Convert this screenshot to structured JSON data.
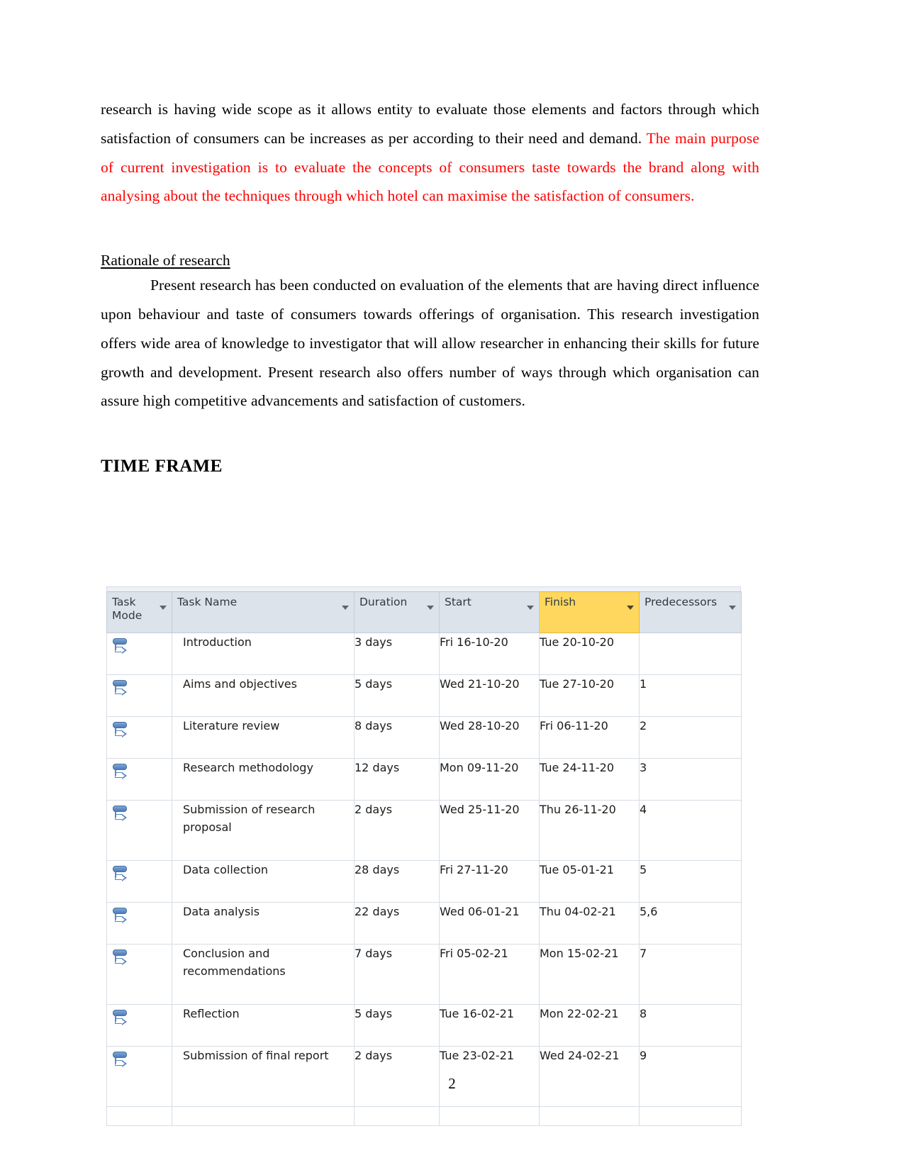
{
  "document": {
    "paragraph_1": {
      "black_part": "research is having wide scope as it allows entity to evaluate those elements and factors through which satisfaction of consumers can be increases as per according to their need and demand.",
      "red_part": " The main purpose of current investigation is to evaluate the concepts of consumers taste towards the brand along with analysing about the techniques through which hotel can maximise the satisfaction of consumers."
    },
    "rationale_heading": "Rationale of research",
    "paragraph_2": "Present research has been conducted on evaluation of the elements that are having direct influence upon behaviour and taste of consumers towards offerings of organisation. This research investigation offers wide area of knowledge to investigator that will allow researcher in enhancing their skills for future growth and development. Present research also offers number of ways through which organisation can assure high competitive advancements and satisfaction of customers.",
    "time_frame_heading": "TIME FRAME",
    "page_number": "2"
  },
  "colors": {
    "red_text": "#ff0000",
    "header_background": "#dde3ea",
    "finish_column_highlight": "#ffd75e",
    "grid_line": "#d6dde4",
    "task_mode_icon": "#5a86bd"
  },
  "project_table": {
    "columns": [
      {
        "key": "task_mode",
        "label": "Task Mode",
        "highlighted": false
      },
      {
        "key": "task_name",
        "label": "Task Name",
        "highlighted": false
      },
      {
        "key": "duration",
        "label": "Duration",
        "highlighted": false
      },
      {
        "key": "start",
        "label": "Start",
        "highlighted": false
      },
      {
        "key": "finish",
        "label": "Finish",
        "highlighted": true
      },
      {
        "key": "predecessors",
        "label": "Predecessors",
        "highlighted": false
      }
    ],
    "rows": [
      {
        "id": 1,
        "mode_icon": "auto-schedule-icon",
        "task_name": "Introduction",
        "duration": "3 days",
        "start": "Fri 16-10-20",
        "finish": "Tue 20-10-20",
        "predecessors": ""
      },
      {
        "id": 2,
        "mode_icon": "auto-schedule-icon",
        "task_name": "Aims and objectives",
        "duration": "5 days",
        "start": "Wed 21-10-20",
        "finish": "Tue 27-10-20",
        "predecessors": "1"
      },
      {
        "id": 3,
        "mode_icon": "auto-schedule-icon",
        "task_name": "Literature review",
        "duration": "8 days",
        "start": "Wed 28-10-20",
        "finish": "Fri 06-11-20",
        "predecessors": "2"
      },
      {
        "id": 4,
        "mode_icon": "auto-schedule-icon",
        "task_name": "Research methodology",
        "duration": "12 days",
        "start": "Mon 09-11-20",
        "finish": "Tue 24-11-20",
        "predecessors": "3"
      },
      {
        "id": 5,
        "mode_icon": "auto-schedule-icon",
        "task_name": "Submission of research proposal",
        "duration": "2 days",
        "start": "Wed 25-11-20",
        "finish": "Thu 26-11-20",
        "predecessors": "4",
        "tall": true
      },
      {
        "id": 6,
        "mode_icon": "auto-schedule-icon",
        "task_name": "Data collection",
        "duration": "28 days",
        "start": "Fri 27-11-20",
        "finish": "Tue 05-01-21",
        "predecessors": "5"
      },
      {
        "id": 7,
        "mode_icon": "auto-schedule-icon",
        "task_name": "Data analysis",
        "duration": "22 days",
        "start": "Wed 06-01-21",
        "finish": "Thu 04-02-21",
        "predecessors": "5,6"
      },
      {
        "id": 8,
        "mode_icon": "auto-schedule-icon",
        "task_name": "Conclusion and recommendations",
        "duration": "7 days",
        "start": "Fri 05-02-21",
        "finish": "Mon 15-02-21",
        "predecessors": "7",
        "tall": true
      },
      {
        "id": 9,
        "mode_icon": "auto-schedule-icon",
        "task_name": "Reflection",
        "duration": "5 days",
        "start": "Tue 16-02-21",
        "finish": "Mon 22-02-21",
        "predecessors": "8"
      },
      {
        "id": 10,
        "mode_icon": "auto-schedule-icon",
        "task_name": "Submission of final report",
        "duration": "2 days",
        "start": "Tue 23-02-21",
        "finish": "Wed 24-02-21",
        "predecessors": "9",
        "tall": true
      }
    ]
  }
}
